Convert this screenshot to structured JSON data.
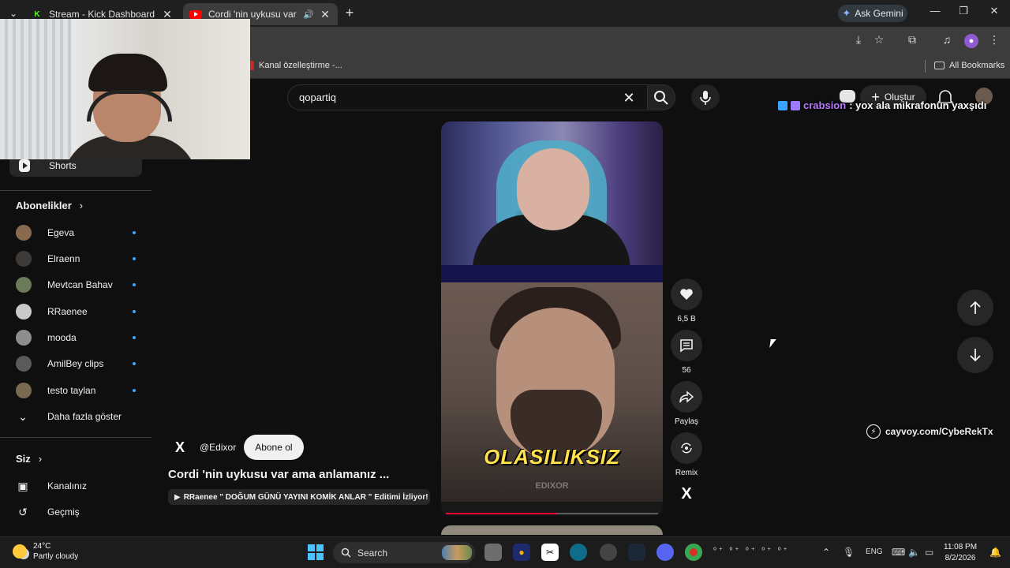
{
  "browser": {
    "tabs": [
      {
        "title": "Stream - Kick Dashboard",
        "favicon": "kick-icon"
      },
      {
        "title": "Cordi 'nin uykusu var ama a",
        "favicon": "youtube-icon",
        "audio": true,
        "active": true
      }
    ],
    "gemini_label": "Ask Gemini",
    "bookmarks": {
      "item": "Kanal özelleştirme -...",
      "all_bookmarks": "All Bookmarks"
    }
  },
  "youtube": {
    "search_value": "qopartiq",
    "create_label": "Oluştur",
    "sidebar": {
      "shorts_label": "Shorts",
      "subscriptions_heading": "Abonelikler",
      "subscriptions": [
        {
          "name": "Egeva",
          "color": "#8a6a4e"
        },
        {
          "name": "Elraenn",
          "color": "#3e3a38"
        },
        {
          "name": "Mevtcan Bahav",
          "color": "#6b7b5a"
        },
        {
          "name": "RRaenee",
          "color": "#c9c9c9"
        },
        {
          "name": "mooda",
          "color": "#8e8e8e"
        },
        {
          "name": "AmilBey clips",
          "color": "#5a5a5a"
        },
        {
          "name": "testo taylan",
          "color": "#7a6a52"
        }
      ],
      "show_more_label": "Daha fazla göster",
      "you_heading": "Siz",
      "you_items": [
        {
          "label": "Kanalınız",
          "icon": "account-box-icon"
        },
        {
          "label": "Geçmiş",
          "icon": "history-icon"
        }
      ]
    },
    "short": {
      "caption_overlay": "OLASILIKSIZ",
      "watermark": "EDIXOR",
      "progress": 0.52,
      "channel_handle": "@Edixor",
      "subscribe_label": "Abone ol",
      "title": "Cordi 'nin uykusu var ama anlamanız ...",
      "related_video": "RRaenee \" DOĞUM GÜNÜ YAYINI KOMİK ANLAR \" Editimi İzliyor! (D...",
      "actions": {
        "likes": "6,5 B",
        "comments": "56",
        "share_label": "Paylaş",
        "remix_label": "Remix"
      }
    }
  },
  "stream_overlay": {
    "chat_user": "crabsion",
    "chat_message": ": yox ala mikrafonun yaxşıdı",
    "promo_text": "cayvoy.com/CybeRekTx"
  },
  "taskbar": {
    "temperature": "24°C",
    "weather": "Partly cloudy",
    "search_label": "Search",
    "language": "ENG",
    "time": "11:08 PM",
    "date": "8/2/2026"
  }
}
